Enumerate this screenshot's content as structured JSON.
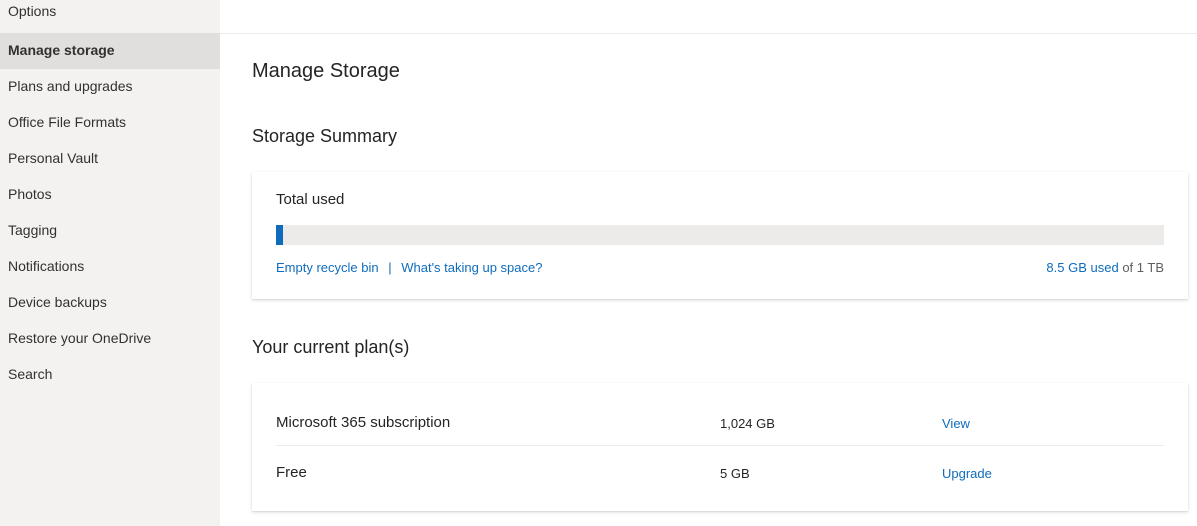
{
  "sidebar": {
    "title": "Options",
    "items": [
      {
        "label": "Manage storage",
        "active": true
      },
      {
        "label": "Plans and upgrades"
      },
      {
        "label": "Office File Formats"
      },
      {
        "label": "Personal Vault"
      },
      {
        "label": "Photos"
      },
      {
        "label": "Tagging"
      },
      {
        "label": "Notifications"
      },
      {
        "label": "Device backups"
      },
      {
        "label": "Restore your OneDrive"
      },
      {
        "label": "Search"
      }
    ]
  },
  "main": {
    "page_title": "Manage Storage",
    "storage_summary": {
      "section_title": "Storage Summary",
      "total_used_label": "Total used",
      "used_fraction": 0.0083,
      "empty_recycle_bin": "Empty recycle bin",
      "separator": "|",
      "whats_taking_space": "What's taking up space?",
      "used_text": "8.5 GB used",
      "of_text": " of 1 TB"
    },
    "plans": {
      "section_title": "Your current plan(s)",
      "rows": [
        {
          "name": "Microsoft 365 subscription",
          "size": "1,024 GB",
          "action": "View"
        },
        {
          "name": "Free",
          "size": "5 GB",
          "action": "Upgrade"
        }
      ]
    }
  },
  "colors": {
    "accent": "#0f6cbd",
    "sidebar_bg": "#f3f2f1",
    "active_bg": "#e1dfdd"
  }
}
